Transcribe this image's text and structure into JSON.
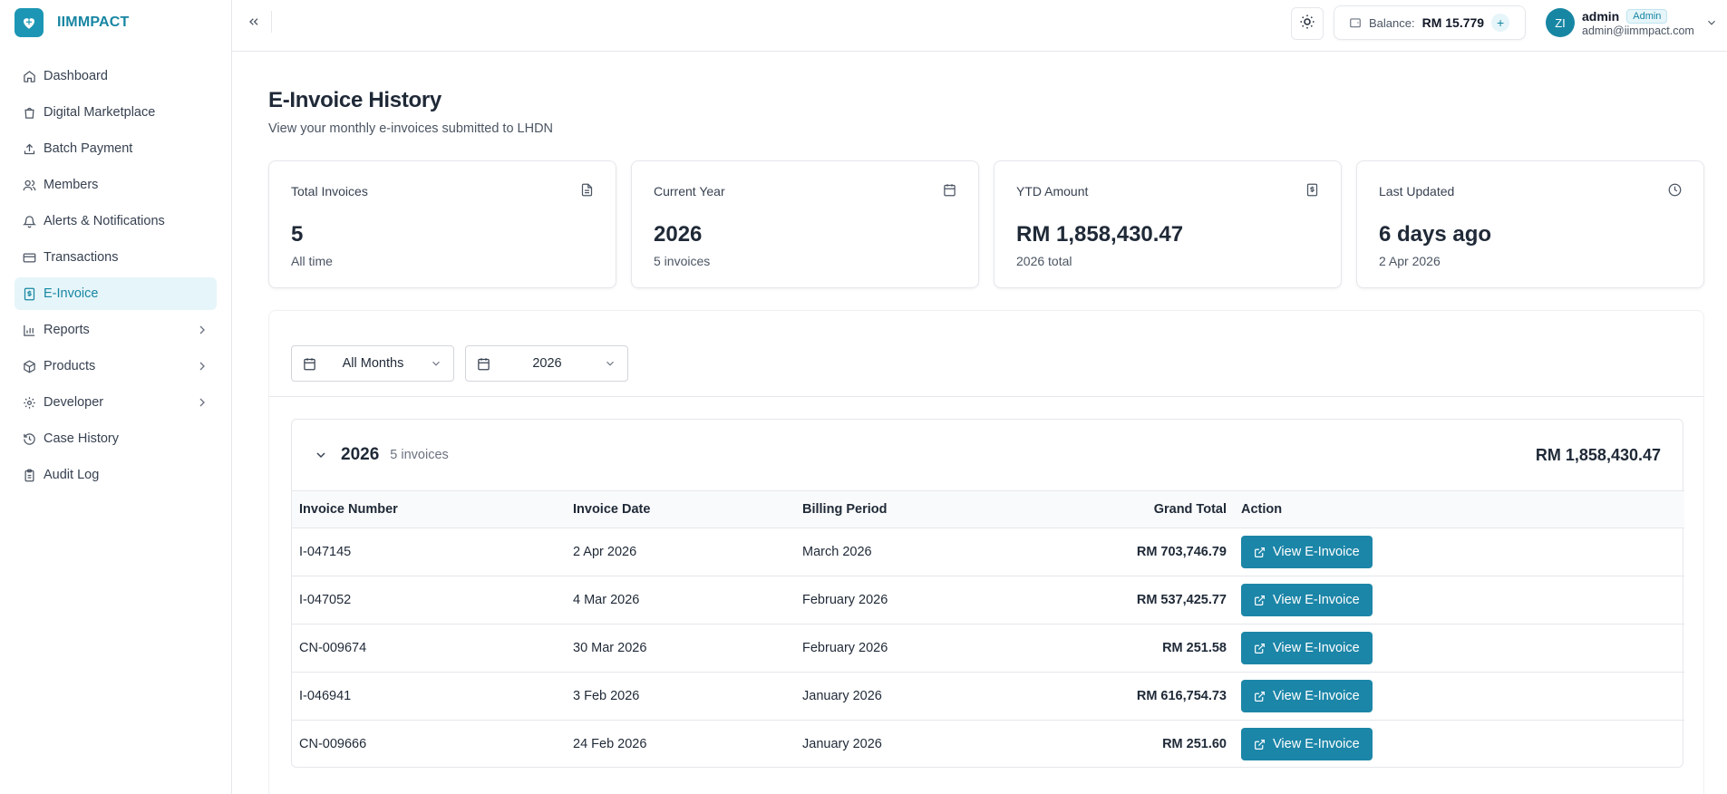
{
  "brand": {
    "name": "IIMMPACT"
  },
  "sidebar": {
    "items": [
      {
        "label": "Dashboard",
        "icon": "home-icon"
      },
      {
        "label": "Digital Marketplace",
        "icon": "shopping-bag-icon"
      },
      {
        "label": "Batch Payment",
        "icon": "upload-icon"
      },
      {
        "label": "Members",
        "icon": "users-icon"
      },
      {
        "label": "Alerts & Notifications",
        "icon": "bell-icon"
      },
      {
        "label": "Transactions",
        "icon": "credit-card-icon"
      },
      {
        "label": "E-Invoice",
        "icon": "receipt-icon",
        "active": true
      },
      {
        "label": "Reports",
        "icon": "bar-chart-icon",
        "expandable": true
      },
      {
        "label": "Products",
        "icon": "package-icon",
        "expandable": true
      },
      {
        "label": "Developer",
        "icon": "gear-icon",
        "expandable": true
      },
      {
        "label": "Case History",
        "icon": "history-icon"
      },
      {
        "label": "Audit Log",
        "icon": "clipboard-icon"
      }
    ]
  },
  "header": {
    "balance_label": "Balance:",
    "balance_value": "RM 15.779",
    "user": {
      "initials": "ZI",
      "name": "admin",
      "role": "Admin",
      "email": "admin@iimmpact.com"
    }
  },
  "page": {
    "title": "E-Invoice History",
    "subtitle": "View your monthly e-invoices submitted to LHDN"
  },
  "stats": [
    {
      "label": "Total Invoices",
      "value": "5",
      "sub": "All time",
      "icon": "file-text-icon"
    },
    {
      "label": "Current Year",
      "value": "2026",
      "sub": "5 invoices",
      "icon": "calendar-icon"
    },
    {
      "label": "YTD Amount",
      "value": "RM 1,858,430.47",
      "sub": "2026 total",
      "icon": "receipt-icon"
    },
    {
      "label": "Last Updated",
      "value": "6 days ago",
      "sub": "2 Apr 2026",
      "icon": "clock-icon"
    }
  ],
  "filters": {
    "month": "All Months",
    "year": "2026"
  },
  "group": {
    "year": "2026",
    "count": "5 invoices",
    "total": "RM 1,858,430.47"
  },
  "table": {
    "headers": [
      "Invoice Number",
      "Invoice Date",
      "Billing Period",
      "Grand Total",
      "Action"
    ],
    "action_label": "View E-Invoice",
    "rows": [
      {
        "number": "I-047145",
        "date": "2 Apr 2026",
        "period": "March 2026",
        "total": "RM 703,746.79"
      },
      {
        "number": "I-047052",
        "date": "4 Mar 2026",
        "period": "February 2026",
        "total": "RM 537,425.77"
      },
      {
        "number": "CN-009674",
        "date": "30 Mar 2026",
        "period": "February 2026",
        "total": "RM 251.58"
      },
      {
        "number": "I-046941",
        "date": "3 Feb 2026",
        "period": "January 2026",
        "total": "RM 616,754.73"
      },
      {
        "number": "CN-009666",
        "date": "24 Feb 2026",
        "period": "January 2026",
        "total": "RM 251.60"
      }
    ]
  },
  "colors": {
    "accent": "#1786a3",
    "button": "#1c86a8",
    "active_bg": "#e6f5f9"
  }
}
